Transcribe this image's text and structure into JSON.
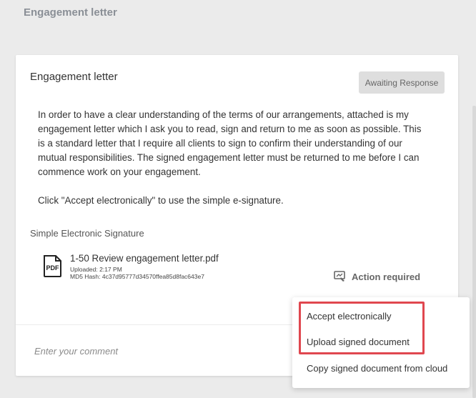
{
  "page": {
    "title": "Engagement letter"
  },
  "card": {
    "title": "Engagement letter",
    "status": "Awaiting Response",
    "paragraph1": "In order to have a clear understanding of the terms of our arrangements, attached is my engagement letter which I ask you to read, sign and return to me as soon as possible. This is a standard letter that I require all clients to sign to confirm their understanding of our mutual responsibilities. The signed engagement letter must be returned to me before I can commence work on your engagement.",
    "paragraph2": "Click \"Accept electronically\" to use the simple e-signature.",
    "signature_label": "Simple Electronic Signature",
    "file": {
      "icon": "pdf-file-icon",
      "icon_text": "PDF",
      "name": "1-50 Review engagement letter.pdf",
      "uploaded": "Uploaded: 2:17 PM",
      "hash": "MD5 Hash: 4c37d95777d34570ffea85d8fac643e7"
    },
    "action": {
      "icon": "signature-action-icon",
      "label": "Action required"
    }
  },
  "comment": {
    "placeholder": "Enter your comment"
  },
  "dropdown": {
    "items": [
      "Accept electronically",
      "Upload signed document",
      "Copy signed document from cloud"
    ]
  },
  "colors": {
    "highlight": "#e0474f",
    "badge_bg": "#dedede",
    "page_bg": "#ebebeb"
  }
}
